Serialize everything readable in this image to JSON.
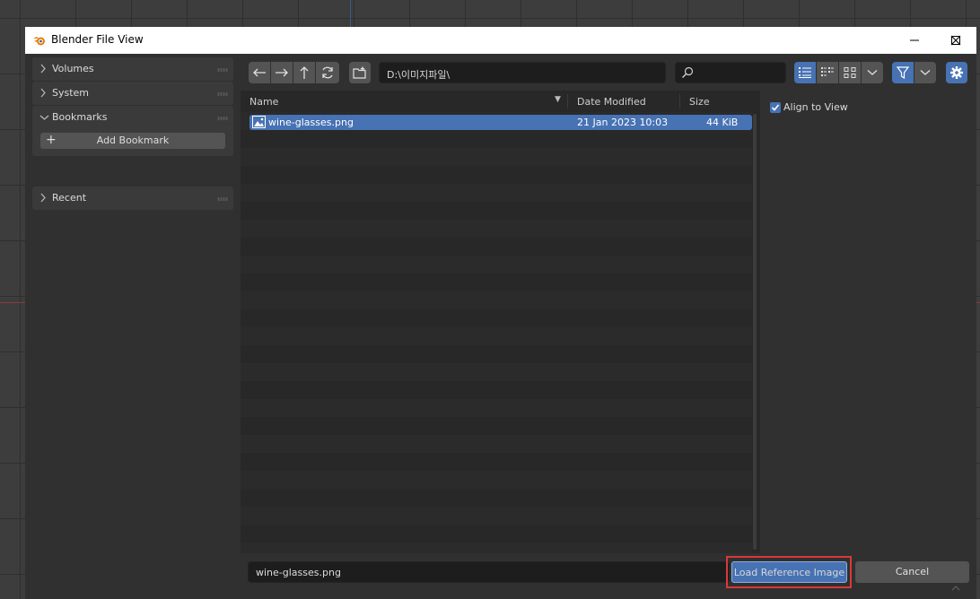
{
  "window": {
    "title": "Blender File View"
  },
  "sidebar": {
    "panels": [
      {
        "label": "Volumes",
        "expanded": false
      },
      {
        "label": "System",
        "expanded": false
      },
      {
        "label": "Bookmarks",
        "expanded": true
      },
      {
        "label": "Recent",
        "expanded": false
      }
    ],
    "add_bookmark_label": "Add Bookmark"
  },
  "toolbar": {
    "path": "D:\\이미지파일\\",
    "search_value": "",
    "display_modes": [
      "vertical-list",
      "horizontal-list",
      "thumbnails"
    ],
    "active_display_mode": "vertical-list",
    "filter_enabled": true
  },
  "file_list": {
    "columns": {
      "name": "Name",
      "date": "Date Modified",
      "size": "Size"
    },
    "files": [
      {
        "name": "wine-glasses.png",
        "date": "21 Jan 2023 10:03",
        "size": "44 KiB",
        "selected": true
      }
    ]
  },
  "options": {
    "align_to_view_label": "Align to View",
    "align_to_view_checked": true
  },
  "footer": {
    "filename": "wine-glasses.png",
    "load_label": "Load Reference Image",
    "cancel_label": "Cancel"
  },
  "colors": {
    "accent": "#4772b3",
    "highlight_outline": "#d63a3a"
  }
}
